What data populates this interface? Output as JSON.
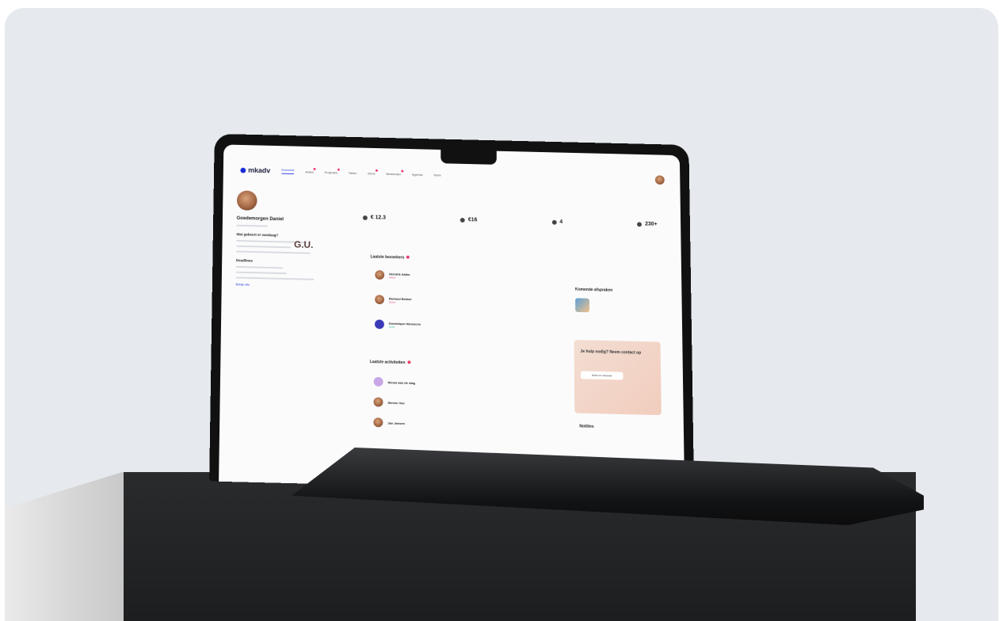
{
  "app": {
    "logo_text": "mkadv"
  },
  "nav": {
    "items": [
      {
        "label": "Overzicht",
        "active": true,
        "badge": false
      },
      {
        "label": "Acties",
        "active": false,
        "badge": true
      },
      {
        "label": "Projecten",
        "active": false,
        "badge": true
      },
      {
        "label": "Taken",
        "active": false,
        "badge": false
      },
      {
        "label": "Inbox",
        "active": false,
        "badge": true
      },
      {
        "label": "Bestanden",
        "active": false,
        "badge": true
      },
      {
        "label": "Agenda",
        "active": false,
        "badge": false
      },
      {
        "label": "Team",
        "active": false,
        "badge": false
      }
    ]
  },
  "sidebar": {
    "title": "Goedemorgen Daniel",
    "signature": "G.U.",
    "section1": "Wat gebeurt er vandaag?",
    "section2": "Deadlines",
    "link": "Bekijk alle"
  },
  "stats": [
    {
      "value": "€ 12.3"
    },
    {
      "value": "€16"
    },
    {
      "value": "4"
    },
    {
      "value": "230+"
    }
  ],
  "recent_title": "Laatste bezoekers",
  "recent_rows": [
    {
      "name": "Hendrik Aalbe",
      "tag": "Nieuw",
      "tag_color": "red"
    },
    {
      "name": "Richard Bekker",
      "tag": "Nieuw",
      "tag_color": "red"
    },
    {
      "name": "Dominique Hanssens",
      "tag": "Actief",
      "tag_color": "green"
    }
  ],
  "activity_title": "Laatste activiteiten",
  "activity_rows": [
    {
      "name": "Nieuw aan de slag"
    },
    {
      "name": "Steven Vos"
    },
    {
      "name": "Jan Jansen"
    }
  ],
  "right_panel": {
    "upcoming_title": "Komende afspraken",
    "promo_title": "Je hulp nodig? Neem contact op",
    "promo_button": "Maak een afspraak",
    "notes_title": "Notities"
  },
  "colors": {
    "brand": "#1c2bd6",
    "badge": "#ea3a6a",
    "success": "#23b48c",
    "background": "#e6eaee"
  }
}
